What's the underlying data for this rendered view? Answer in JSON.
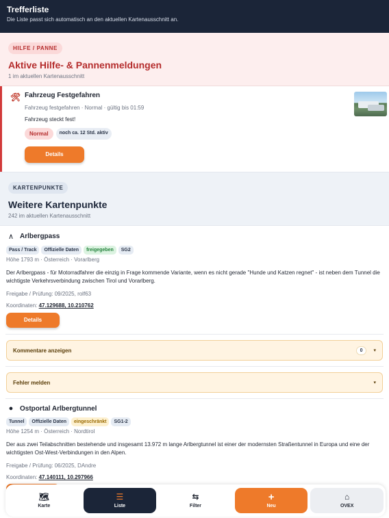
{
  "header": {
    "title": "Trefferliste",
    "subtitle": "Die Liste passt sich automatisch an den aktuellen Kartenausschnitt an."
  },
  "hilfe": {
    "tag": "HILFE / PANNE",
    "heading": "Aktive Hilfe- & Pannenmeldungen",
    "count_text": "1 im aktuellen Kartenausschnitt",
    "card": {
      "icon": "breakdown-icon",
      "title": "Fahrzeug Festgefahren",
      "meta": "Fahrzeug festgefahren · Normal · gültig bis 01:59",
      "text": "Fahrzeug steckt fest!",
      "badge_priority": "Normal",
      "badge_validity": "noch ca. 12 Std. aktiv",
      "details_label": "Details"
    }
  },
  "kartenpunkte": {
    "tag": "KARTENPUNKTE",
    "heading": "Weitere Kartenpunkte",
    "count_text": "242 im aktuellen Kartenausschnitt"
  },
  "pois": [
    {
      "icon": "pass-icon",
      "title": "Arlbergpass",
      "tags": [
        "Pass / Track",
        "Offizielle Daten",
        "freigegeben",
        "SG2"
      ],
      "meta": "Höhe 1793 m · Österreich · Vorarlberg",
      "description": "Der Arlbergpass - für Motorradfahrer die einzig in Frage kommende Variante, wenn es nicht gerade \"Hunde und Katzen regnet\" - ist neben dem Tunnel die wichtigste Verkehrsverbindung zwischen Tirol und Vorarlberg.",
      "release": "Freigabe / Prüfung: 09/2025, rolf63",
      "coord_label": "Koordinaten:",
      "coords": "47.129688, 10.210762",
      "details_label": "Details",
      "comments_label": "Kommentare anzeigen",
      "comments_count": "0",
      "report_label": "Fehler melden"
    },
    {
      "icon": "tunnel-dot-icon",
      "title": "Ostportal Arlbergtunnel",
      "tags": [
        "Tunnel",
        "Offizielle Daten",
        "eingeschränkt",
        "SG1-2"
      ],
      "meta": "Höhe 1254 m · Österreich · Nordtirol",
      "description": "Der aus zwei Teilabschnitten bestehende und insgesamt 13.972 m lange Arlbergtunnel ist einer der modernsten Straßentunnel in Europa und eine der wichtigsten Ost-West-Verbindungen in den Alpen.",
      "release": "Freigabe / Prüfung: 06/2025, DAndre",
      "coord_label": "Koordinaten:",
      "coords": "47.140111, 10.297966"
    }
  ],
  "nav": {
    "karte": "Karte",
    "liste": "Liste",
    "filter": "Filter",
    "neu": "Neu",
    "ovex": "OVEX"
  },
  "colors": {
    "navy": "#1b2538",
    "accent_orange": "#ee7a2a",
    "alert_red": "#d23a3a",
    "status_green": "#23823b",
    "status_yellow": "#9a6a00"
  }
}
